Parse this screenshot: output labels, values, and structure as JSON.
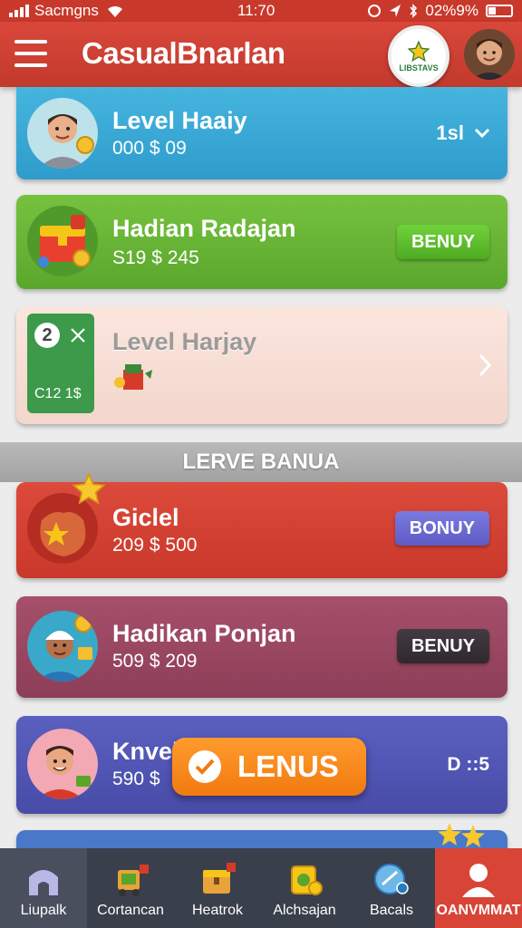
{
  "status_bar": {
    "carrier": "Sacmgns",
    "time": "11:70",
    "battery": "02%9%"
  },
  "header": {
    "title": "CasualBnarlan",
    "badge_text": "LIBSTAVS",
    "menu_icon": "hamburger-icon"
  },
  "cards": [
    {
      "title": "Level Haaiy",
      "sub": "000 $ 09",
      "right_text": "1sl",
      "right_icon": "chevron-down-icon"
    },
    {
      "title": "Hadian Radajan",
      "sub": "S19 $ 245",
      "button": "BENUY"
    },
    {
      "title": "Level Harjay",
      "tile_number": "2",
      "tile_text": "C12 1$",
      "right_icon": "chevron-right-icon"
    },
    {
      "title": "Giclel",
      "sub": "209 $ 500",
      "button": "BONUY"
    },
    {
      "title": "Hadikan Ponjan",
      "sub": "509 $ 209",
      "button": "BENUY"
    },
    {
      "title": "Knvel",
      "sub": "590 $",
      "right_text": "D ::5"
    }
  ],
  "section": {
    "label": "LERVE BANUA"
  },
  "overlay_button": {
    "label": "LENUS"
  },
  "nav": [
    {
      "label": "Liupalk",
      "icon": "house-icon"
    },
    {
      "label": "Cortancan",
      "icon": "cart-icon"
    },
    {
      "label": "Heatrok",
      "icon": "chest-icon"
    },
    {
      "label": "Alchsajan",
      "icon": "coins-icon"
    },
    {
      "label": "Bacals",
      "icon": "globe-icon"
    },
    {
      "label": "OANVMMAT",
      "icon": "profile-icon"
    }
  ],
  "colors": {
    "header": "#c8392b",
    "card_blue": "#3aa8d6",
    "card_green": "#68b535",
    "card_peach": "#f6ddd3",
    "card_red": "#d24233",
    "card_plum": "#9a4762",
    "card_indigo": "#5256b4",
    "button_green": "#5fbf2f",
    "button_purple": "#6b6ad0",
    "button_dark": "#3a343a",
    "overlay_orange": "#f5871c"
  }
}
